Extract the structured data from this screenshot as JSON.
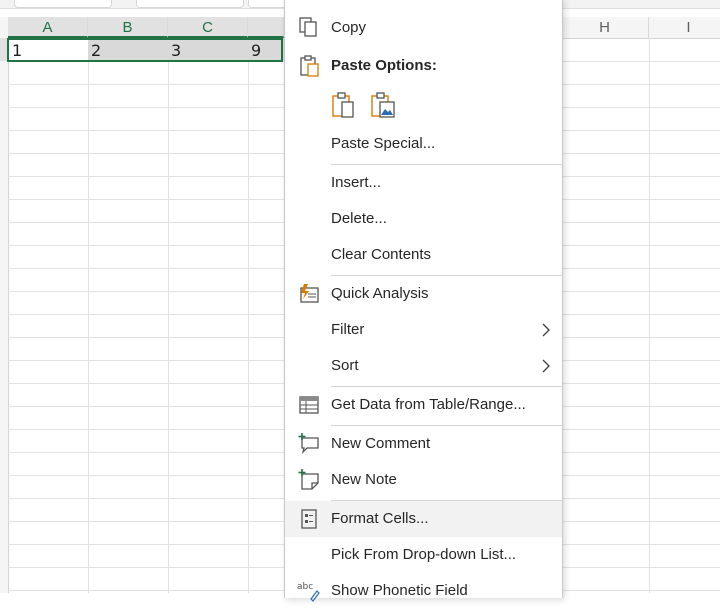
{
  "sheet": {
    "columns": [
      "A",
      "B",
      "C",
      "H",
      "I"
    ],
    "row1": [
      "1",
      "2",
      "3",
      "9"
    ]
  },
  "menu": {
    "copy": "Copy",
    "paste_options": "Paste Options:",
    "paste_special": "Paste Special...",
    "insert": "Insert...",
    "delete": "Delete...",
    "clear_contents": "Clear Contents",
    "quick_analysis": "Quick Analysis",
    "filter": "Filter",
    "sort": "Sort",
    "get_data": "Get Data from Table/Range...",
    "new_comment": "New Comment",
    "new_note": "New Note",
    "format_cells": "Format Cells...",
    "pick_from_list": "Pick From Drop-down List...",
    "show_phonetic": "Show Phonetic Field"
  },
  "icons": {
    "copy": "copy-icon",
    "paste": "clipboard-icon",
    "paste_keep": "paste-clipboard-icon",
    "paste_picture": "paste-picture-icon",
    "quick_analysis": "quick-analysis-icon",
    "get_data": "table-icon",
    "new_comment": "comment-plus-icon",
    "new_note": "note-plus-icon",
    "format_cells": "format-cells-icon",
    "phonetic": "phonetic-icon",
    "submenu": "chevron-right-icon"
  },
  "colors": {
    "accent": "#217346",
    "paste_orange": "#d87b00"
  }
}
